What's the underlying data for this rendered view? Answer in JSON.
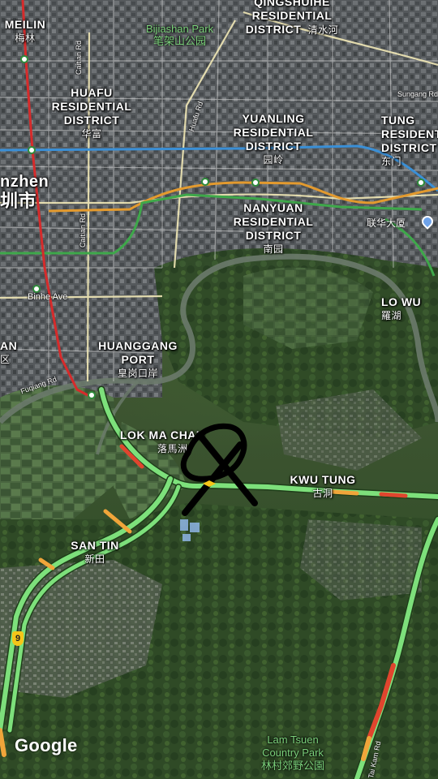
{
  "map": {
    "places": [
      {
        "en": "QINGSHUIHE RESIDENTIAL DISTRICT",
        "lines": [
          "QINGSHUIHE",
          "RESIDENTIAL",
          "DISTRICT"
        ],
        "zh": "清水河"
      },
      {
        "en": "HUAFU RESIDENTIAL DISTRICT",
        "lines": [
          "HUAFU",
          "RESIDENTIAL",
          "DISTRICT"
        ],
        "zh": "华富"
      },
      {
        "en": "YUANLING RESIDENTIAL DISTRICT",
        "lines": [
          "YUANLING",
          "RESIDENTIAL",
          "DISTRICT"
        ],
        "zh": "园岭"
      },
      {
        "en": "TUNG RESIDENTIAL DISTRICT",
        "lines": [
          "TUNG",
          "RESIDENTIAL",
          "DISTRICT"
        ],
        "zh": "东门"
      },
      {
        "en": "NANYUAN RESIDENTIAL DISTRICT",
        "lines": [
          "NANYUAN",
          "RESIDENTIAL",
          "DISTRICT"
        ],
        "zh": "南园"
      },
      {
        "en": "HUANGGANG PORT",
        "lines": [
          "HUANGGANG",
          "PORT"
        ],
        "zh": "皇岗口岸"
      },
      {
        "en": "LO WU",
        "lines": [
          "LO WU"
        ],
        "zh": "羅湖"
      },
      {
        "en": "LOK MA CHAU",
        "lines": [
          "LOK MA CHAU"
        ],
        "zh": "落馬洲"
      },
      {
        "en": "KWU TUNG",
        "lines": [
          "KWU TUNG"
        ],
        "zh": "古洞"
      },
      {
        "en": "SAN TIN",
        "lines": [
          "SAN TIN"
        ],
        "zh": "新田"
      },
      {
        "en": "MEILIN",
        "lines": [
          "MEILIN"
        ],
        "zh": "梅林"
      },
      {
        "en": "Shenzhen",
        "lines": [
          "nzhen"
        ],
        "zh": "圳市"
      },
      {
        "en": "AN",
        "lines": [
          "AN"
        ],
        "zh": "区"
      }
    ],
    "parks": [
      {
        "en": "Bijiashan Park",
        "zh": "笔架山公园"
      },
      {
        "en": "Lam Tsuen Country Park",
        "en_lines": [
          "Lam Tsuen",
          "Country Park"
        ],
        "zh": "林村郊野公園"
      }
    ],
    "roads": [
      "Caitian Rd",
      "Caitian Rd",
      "Huafu Rd",
      "Binhe Ave",
      "Fuqiang Rd",
      "Sungang Rd",
      "Tai Kam Rd"
    ],
    "poi": {
      "name": "联华大厦",
      "icon": "map-pin-icon"
    },
    "route_shield": "9",
    "attribution": "Google",
    "colors": {
      "traffic_clear": "#7de07b",
      "traffic_slow": "#f0a53a",
      "traffic_heavy": "#e0452e",
      "metro_blue": "#3a8fd6",
      "metro_orange": "#e39a2e",
      "metro_green": "#3ea84a",
      "metro_red": "#d62b2b",
      "annotation": "#000000"
    },
    "annotation": {
      "type": "hand-drawn circled X mark",
      "icon": "x-circle-annotation"
    }
  }
}
